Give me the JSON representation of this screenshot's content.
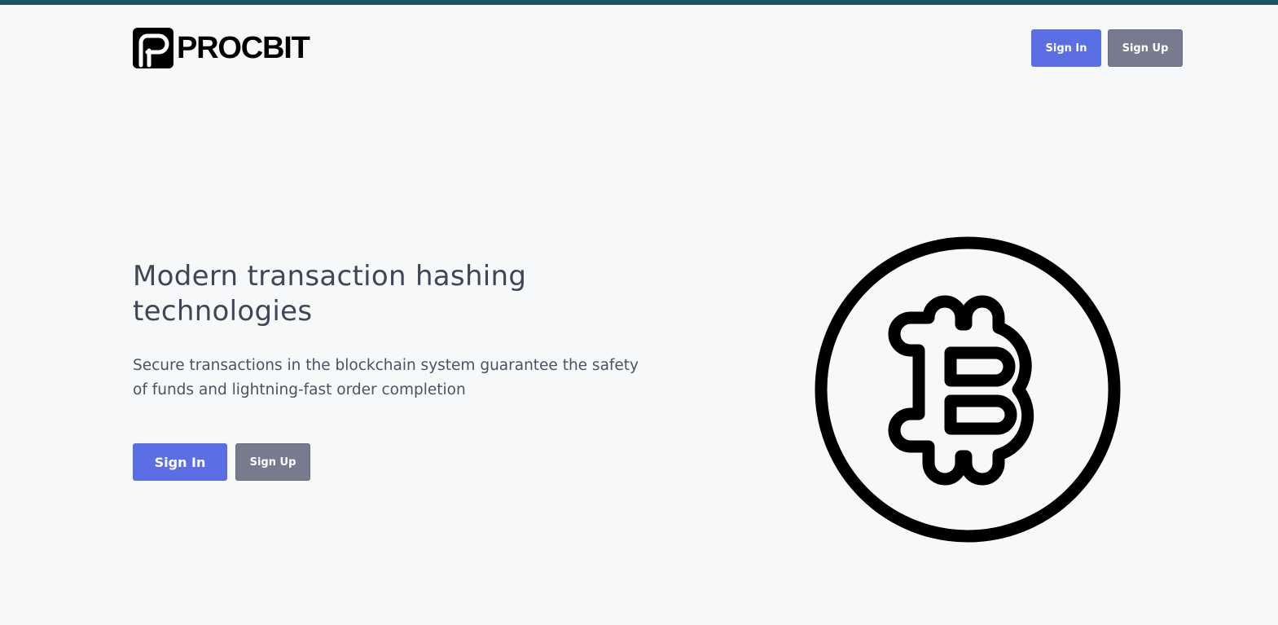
{
  "header": {
    "logo_text": "PROCBIT",
    "signin_label": "Sign In",
    "signup_label": "Sign Up"
  },
  "hero": {
    "title": "Modern transaction hashing technologies",
    "subtitle": "Secure transactions in the blockchain system guarantee the safety of funds and lightning-fast order completion",
    "signin_label": "Sign In",
    "signup_label": "Sign Up"
  },
  "icons": {
    "logo": "procbit-logo-icon",
    "illustration": "bitcoin-icon"
  },
  "colors": {
    "accent_bar": "#1d5661",
    "primary_button": "#5a6fe3",
    "secondary_button": "#777b8e",
    "background": "#f7f8fa",
    "heading_text": "#3f4655"
  }
}
